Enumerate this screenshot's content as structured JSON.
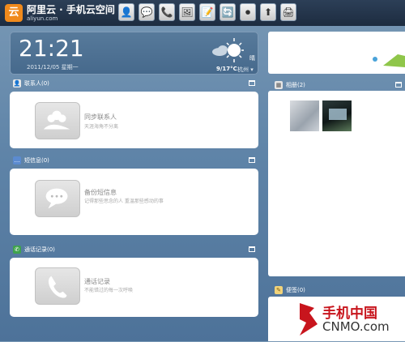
{
  "brand": {
    "logo_glyph": "云",
    "title": "阿里云 · 手机云空间",
    "url": "aliyun.com"
  },
  "toolbar": {
    "buttons": [
      {
        "name": "contacts-app-icon",
        "glyph": "👤"
      },
      {
        "name": "messages-app-icon",
        "glyph": "💬"
      },
      {
        "name": "phone-app-icon",
        "glyph": "📞"
      },
      {
        "name": "gallery-app-icon",
        "glyph": "🖼"
      },
      {
        "name": "notes-app-icon",
        "glyph": "📝"
      },
      {
        "name": "sync-app-icon",
        "glyph": "🔄"
      },
      {
        "name": "record-app-icon",
        "glyph": "⏺"
      },
      {
        "name": "backup-app-icon",
        "glyph": "⬆"
      },
      {
        "name": "printer-app-icon",
        "glyph": "🖨"
      }
    ]
  },
  "clock": {
    "time": "21:21",
    "date": "2011/12/05 星期一",
    "weather": "晴",
    "temperature": "9/17°C",
    "city": "杭州 ▾"
  },
  "contacts": {
    "header": "联系人(0)",
    "title": "同步联系人",
    "subtitle": "天涯海角不分离"
  },
  "sms": {
    "header": "短信息(0)",
    "title": "备份短信息",
    "subtitle": "记得那些思念的人 重温那些感动的事"
  },
  "calls": {
    "header": "通话记录(0)",
    "title": "通话记录",
    "subtitle": "不能错过的每一次呼唤"
  },
  "album": {
    "header": "相册(2)"
  },
  "notes": {
    "header": "便签(0)"
  },
  "watermark": {
    "cn": "手机中国",
    "en": "CNMO.com"
  },
  "colors": {
    "accent_orange": "#f08a1c",
    "topbar": "#1d2c40",
    "watermark_red": "#c8151d"
  }
}
